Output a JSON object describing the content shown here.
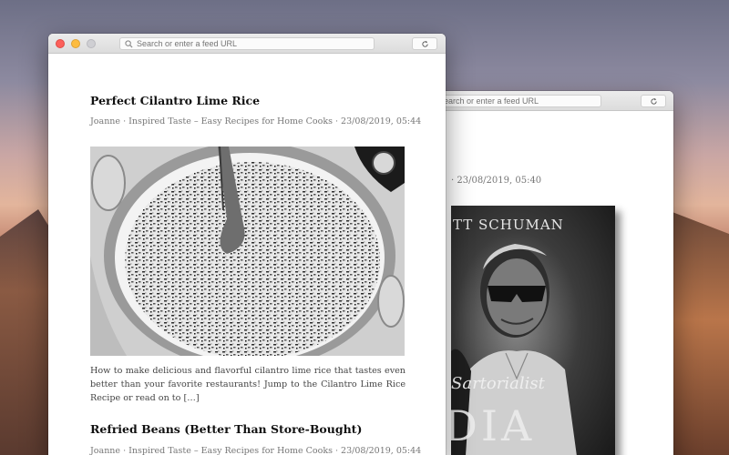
{
  "colors": {
    "accent_red": "#fc605b",
    "accent_yellow": "#fdbc40",
    "text_meta": "#777777"
  },
  "back_window": {
    "url_placeholder": "Search or enter a feed URL",
    "article_meta": "· 23/08/2019, 05:40",
    "cover": {
      "top_text": "ETT SCHUMAN",
      "script_text": "Sartorialist",
      "big_text": "DIA"
    }
  },
  "front_window": {
    "url_placeholder": "Search or enter a feed URL",
    "articles": [
      {
        "title": "Perfect Cilantro Lime Rice",
        "meta": "Joanne · Inspired Taste – Easy Recipes for Home Cooks · 23/08/2019, 05:44",
        "excerpt": "How to make delicious and flavorful cilantro lime rice that tastes even better than your favorite restaurants! Jump to the Cilantro Lime Rice Recipe or read on to […]"
      },
      {
        "title": "Refried Beans (Better Than Store-Bought)",
        "meta": "Joanne · Inspired Taste – Easy Recipes for Home Cooks · 23/08/2019, 05:44"
      }
    ]
  },
  "icons": {
    "search": "search-icon",
    "reload": "reload-icon"
  }
}
